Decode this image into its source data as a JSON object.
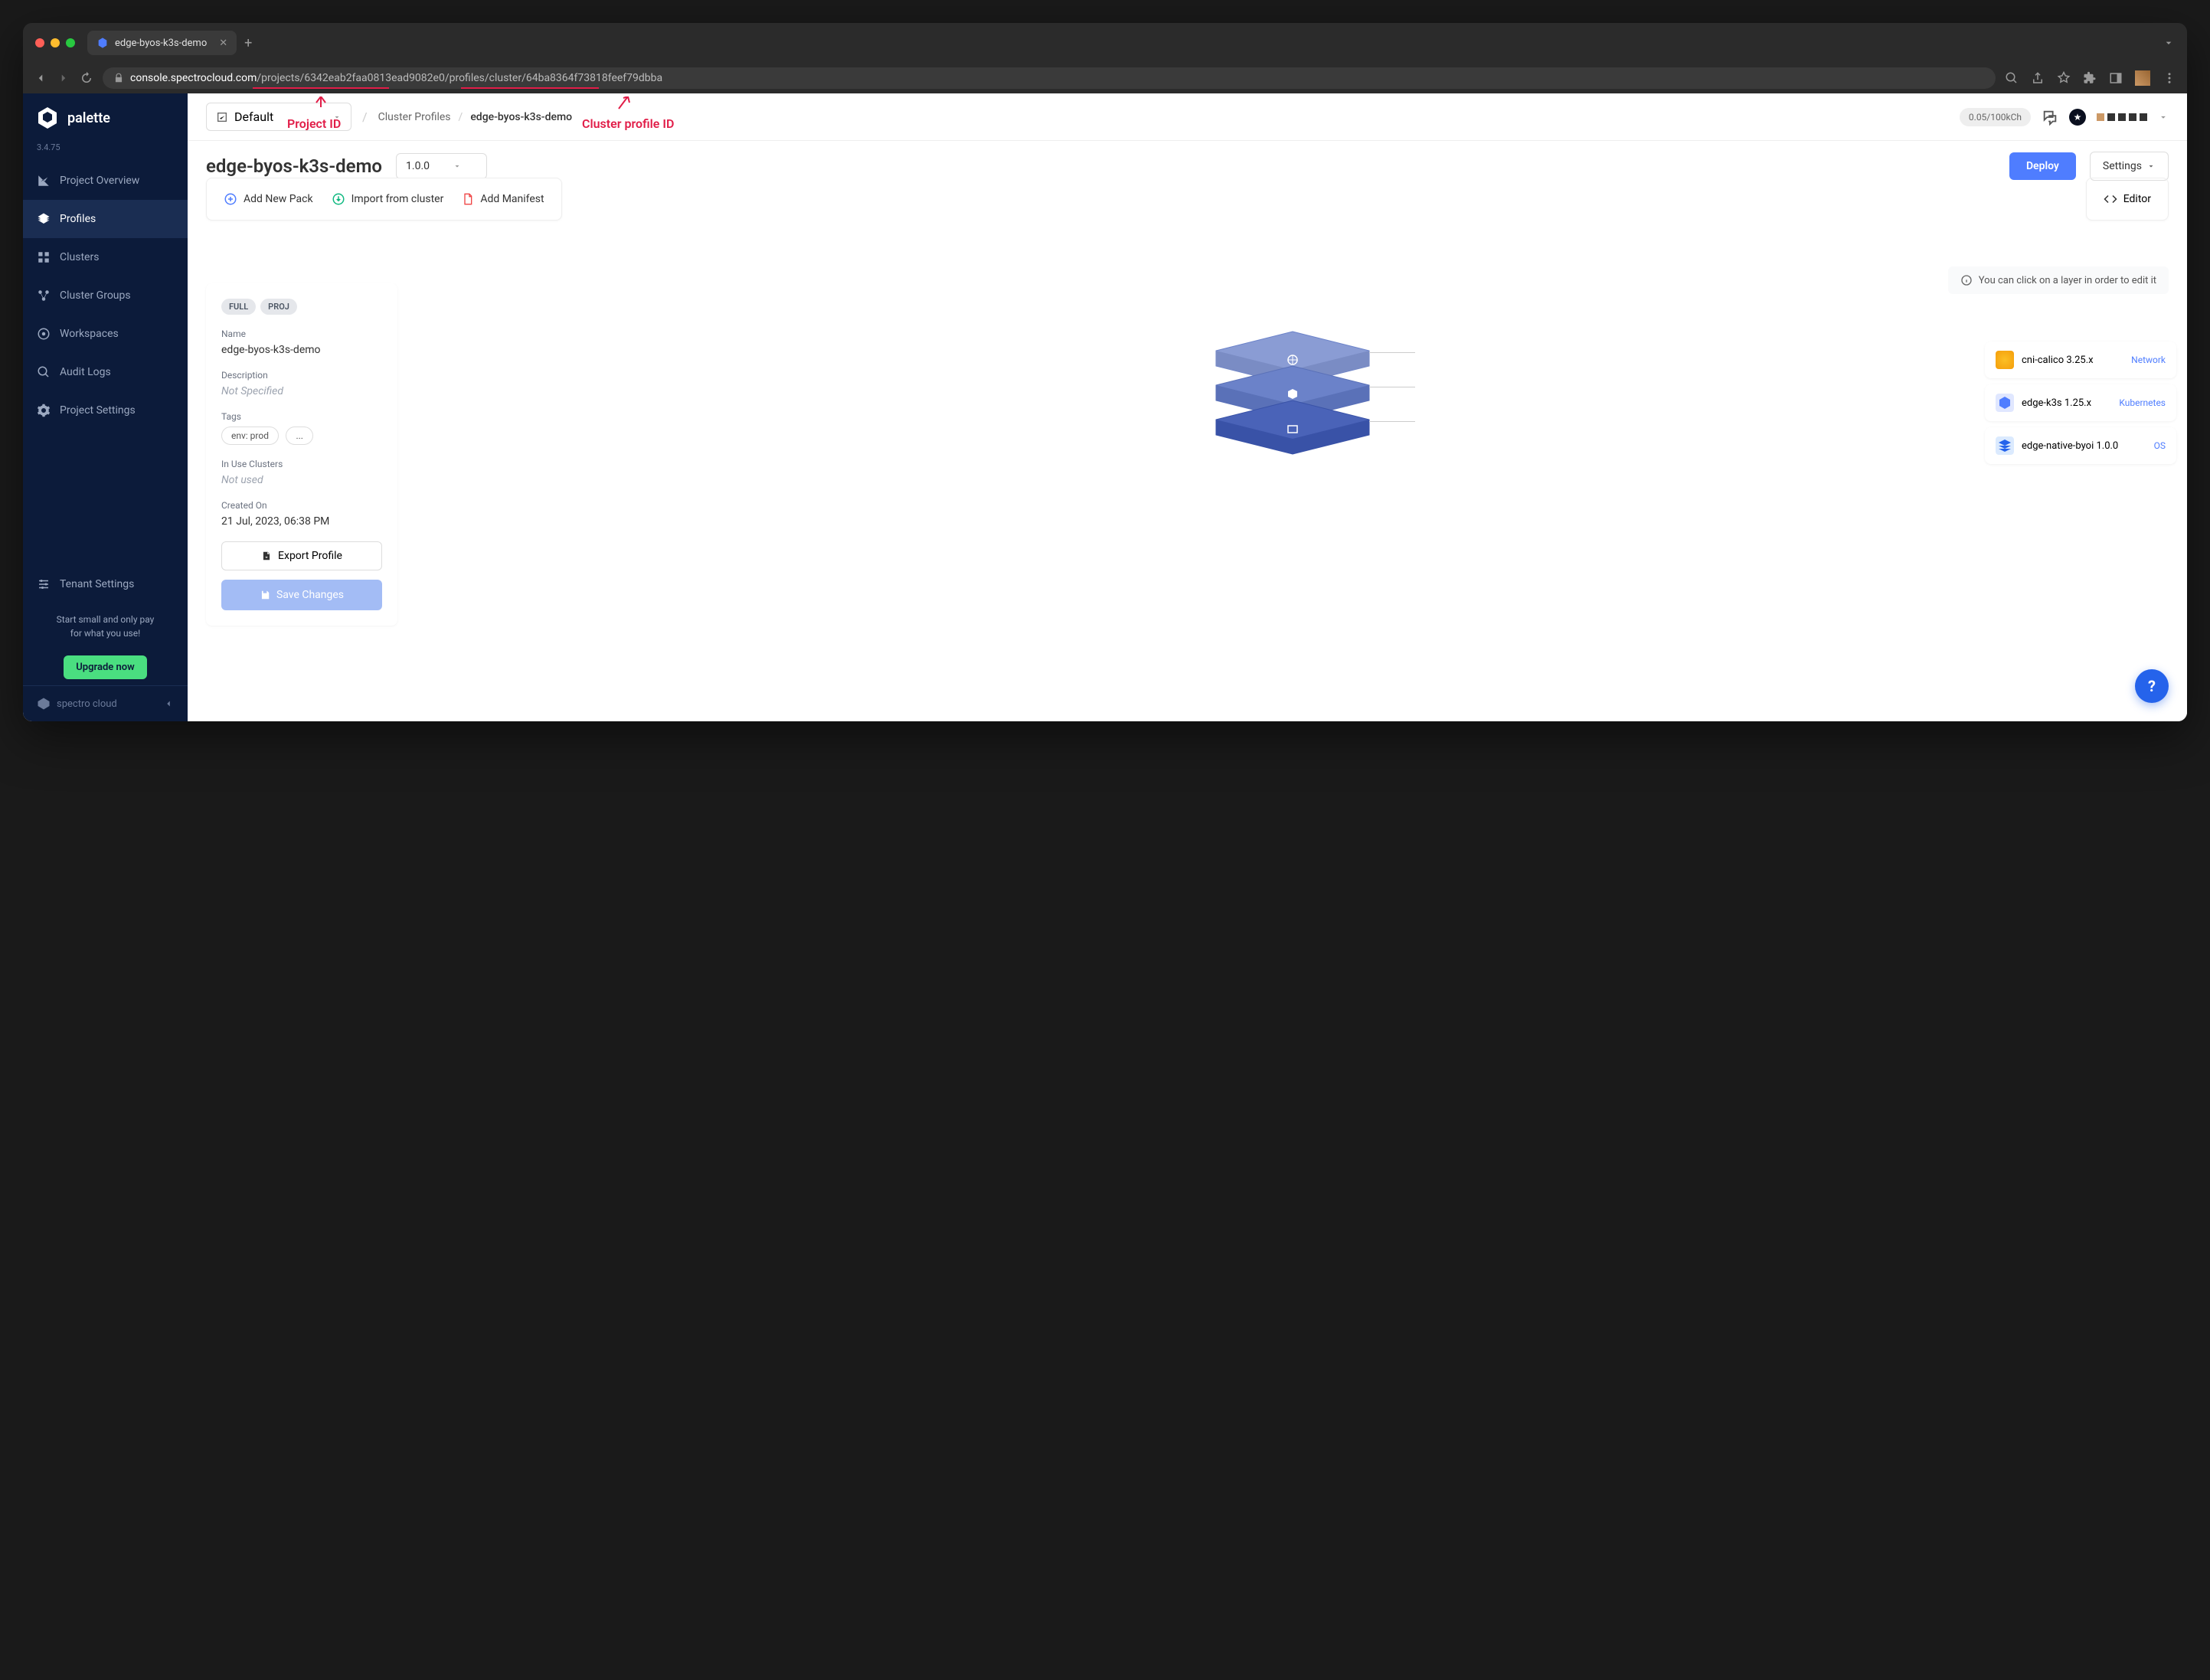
{
  "browser": {
    "tab_title": "edge-byos-k3s-demo",
    "url_host": "console.spectrocloud.com",
    "url_path": "/projects/6342eab2faa0813ead9082e0/profiles/cluster/64ba8364f73818feef79dbba"
  },
  "annotations": {
    "project_id": "Project ID",
    "cluster_profile_id": "Cluster profile ID"
  },
  "brand": {
    "name": "palette",
    "version": "3.4.75"
  },
  "nav": {
    "items": [
      {
        "label": "Project Overview",
        "icon": "chart"
      },
      {
        "label": "Profiles",
        "icon": "layers",
        "active": true
      },
      {
        "label": "Clusters",
        "icon": "grid"
      },
      {
        "label": "Cluster Groups",
        "icon": "nodes"
      },
      {
        "label": "Workspaces",
        "icon": "workspace"
      },
      {
        "label": "Audit Logs",
        "icon": "magnify"
      },
      {
        "label": "Project Settings",
        "icon": "gear"
      }
    ],
    "tenant": "Tenant Settings",
    "promo_line1": "Start small and only pay",
    "promo_line2": "for what you use!",
    "upgrade": "Upgrade now",
    "footer": "spectro cloud"
  },
  "header": {
    "scope": "Default",
    "breadcrumb_parent": "Cluster Profiles",
    "breadcrumb_current": "edge-byos-k3s-demo",
    "credits": "0.05/100kCh"
  },
  "page": {
    "title": "edge-byos-k3s-demo",
    "version": "1.0.0",
    "deploy": "Deploy",
    "settings": "Settings"
  },
  "actions": {
    "add_pack": "Add New Pack",
    "import": "Import from cluster",
    "manifest": "Add Manifest",
    "editor": "Editor"
  },
  "hint": "You can click on a layer in order to edit it",
  "info": {
    "badge_full": "FULL",
    "badge_proj": "PROJ",
    "name_label": "Name",
    "name_value": "edge-byos-k3s-demo",
    "desc_label": "Description",
    "desc_value": "Not Specified",
    "tags_label": "Tags",
    "tag1": "env: prod",
    "tag_more": "...",
    "inuse_label": "In Use Clusters",
    "inuse_value": "Not used",
    "created_label": "Created On",
    "created_value": "21 Jul, 2023, 06:38 PM",
    "export": "Export Profile",
    "save": "Save Changes"
  },
  "layers": [
    {
      "name": "cni-calico 3.25.x",
      "type": "Network",
      "color": "#8a9cd4"
    },
    {
      "name": "edge-k3s 1.25.x",
      "type": "Kubernetes",
      "color": "#6b82c9"
    },
    {
      "name": "edge-native-byoi 1.0.0",
      "type": "OS",
      "color": "#4a63b8"
    }
  ]
}
